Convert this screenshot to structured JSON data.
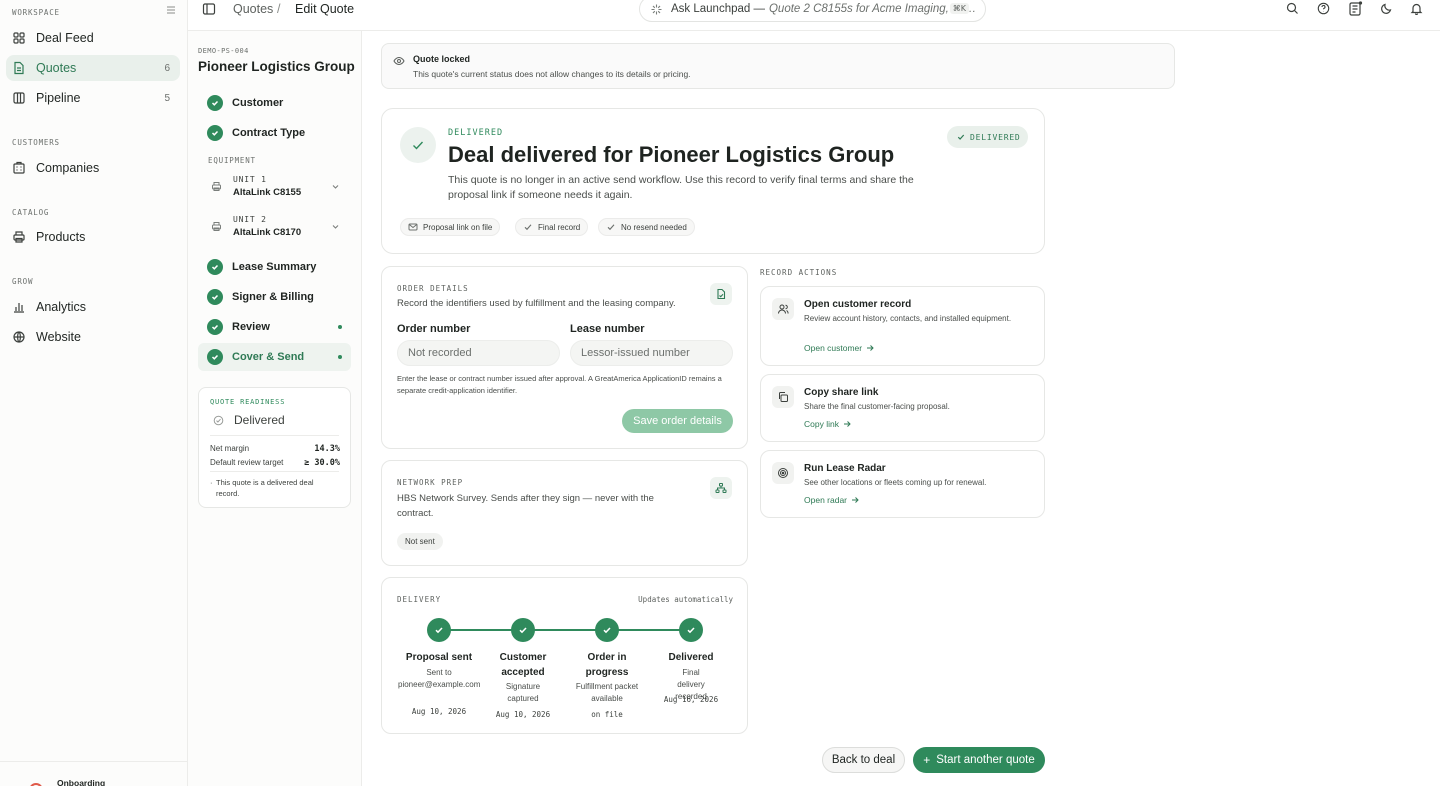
{
  "sidebar": {
    "sections": {
      "workspace": "WORKSPACE",
      "customers": "CUSTOMERS",
      "catalog": "CATALOG",
      "grow": "GROW"
    },
    "items": {
      "deal_feed": {
        "label": "Deal Feed"
      },
      "quotes": {
        "label": "Quotes",
        "badge": "6"
      },
      "pipeline": {
        "label": "Pipeline",
        "badge": "5"
      },
      "companies": {
        "label": "Companies"
      },
      "products": {
        "label": "Products"
      },
      "analytics": {
        "label": "Analytics"
      },
      "website": {
        "label": "Website"
      }
    },
    "bottom": {
      "label": "Onboarding"
    }
  },
  "topbar": {
    "breadcrumb": {
      "root": "Quotes",
      "sep": "/",
      "current": "Edit Quote"
    },
    "ask": {
      "label": "Ask Launchpad —",
      "query": "Quote 2 C8155s for Acme Imaging, 60…",
      "shortcut": "⌘K"
    },
    "icons": [
      "search-icon",
      "help-icon",
      "notes-icon",
      "moon-icon",
      "bell-icon"
    ]
  },
  "stepper": {
    "code": "DEMO-PS-004",
    "title": "Pioneer Logistics Group",
    "steps_top": [
      {
        "label": "Customer"
      },
      {
        "label": "Contract Type"
      }
    ],
    "equipment_label": "EQUIPMENT",
    "units": [
      {
        "label": "UNIT 1",
        "model": "AltaLink C8155"
      },
      {
        "label": "UNIT 2",
        "model": "AltaLink C8170"
      }
    ],
    "steps_bottom": [
      {
        "label": "Lease Summary"
      },
      {
        "label": "Signer & Billing"
      },
      {
        "label": "Review"
      },
      {
        "label": "Cover & Send"
      }
    ],
    "readiness": {
      "label": "QUOTE READINESS",
      "status": "Delivered",
      "net_margin_label": "Net margin",
      "net_margin_value": "14.3%",
      "target_label": "Default review target",
      "target_value": "≥ 30.0%",
      "note": "This quote is a delivered deal record."
    }
  },
  "lock": {
    "title": "Quote locked",
    "desc": "This quote's current status does not allow changes to its details or pricing."
  },
  "hero": {
    "kicker": "DELIVERED",
    "title": "Deal delivered for Pioneer Logistics Group",
    "desc": "This quote is no longer in an active send workflow. Use this record to verify final terms and share the proposal link if someone needs it again.",
    "status_pill": "DELIVERED",
    "chips": [
      "Proposal link on file",
      "Final record",
      "No resend needed"
    ]
  },
  "order": {
    "section": "ORDER DETAILS",
    "desc": "Record the identifiers used by fulfillment and the leasing company.",
    "order_label": "Order number",
    "order_placeholder": "Not recorded",
    "lease_label": "Lease number",
    "lease_placeholder": "Lessor-issued number",
    "helper": "Enter the lease or contract number issued after approval. A GreatAmerica ApplicationID remains a separate credit-application identifier.",
    "save": "Save order details"
  },
  "network": {
    "section": "NETWORK PREP",
    "desc": "HBS Network Survey. Sends after they sign — never with the contract.",
    "status": "Not sent"
  },
  "delivery": {
    "section": "DELIVERY",
    "auto": "Updates automatically",
    "steps": [
      {
        "title": "Proposal sent",
        "sub": "Sent to pioneer@example.com",
        "date": "Aug 10, 2026"
      },
      {
        "title": "Customer accepted",
        "sub": "Signature captured",
        "date": "Aug 10, 2026"
      },
      {
        "title": "Order in progress",
        "sub": "Fulfillment packet available",
        "date": "on file"
      },
      {
        "title": "Delivered",
        "sub": "Final delivery recorded",
        "date": "Aug 16, 2026"
      }
    ]
  },
  "record_actions": {
    "label": "RECORD ACTIONS",
    "items": [
      {
        "title": "Open customer record",
        "desc": "Review account history, contacts, and installed equipment.",
        "link": "Open customer"
      },
      {
        "title": "Copy share link",
        "desc": "Share the final customer-facing proposal.",
        "link": "Copy link"
      },
      {
        "title": "Run Lease Radar",
        "desc": "See other locations or fleets coming up for renewal.",
        "link": "Open radar"
      }
    ]
  },
  "footer": {
    "back": "Back to deal",
    "start": "Start another quote"
  },
  "colors": {
    "accent": "#2f8a5c",
    "accent_light": "#e9f0eb",
    "save_disabled": "#8ec8a6"
  }
}
